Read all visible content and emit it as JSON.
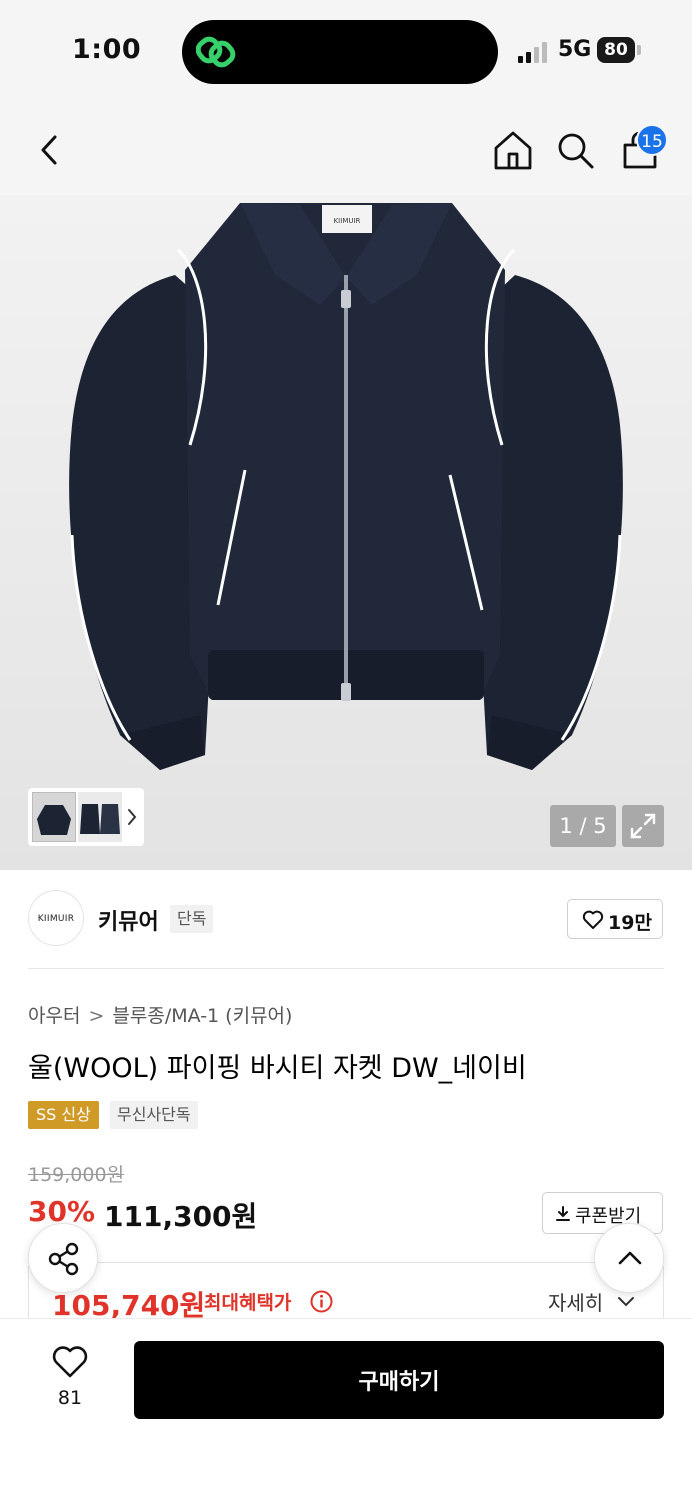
{
  "status_bar": {
    "time": "1:00",
    "network": "5G",
    "battery": "80"
  },
  "nav": {
    "back_icon": "chevron-left-icon",
    "home_icon": "home-icon",
    "search_icon": "search-icon",
    "cart_icon": "shopping-bag-icon",
    "cart_count": "15"
  },
  "gallery": {
    "image_label": "KIIMUIR",
    "counter": "1 / 5",
    "expand_icon": "expand-icon"
  },
  "brand": {
    "logo_text": "KIIMUIR",
    "name": "키뮤어",
    "tag": "단독",
    "like_count": "19만"
  },
  "product": {
    "breadcrumb": [
      "아우터",
      "블루종/MA-1 (키뮤어)"
    ],
    "title": "울(WOOL) 파이핑 바시티 자켓 DW_네이비",
    "badges": [
      "SS 신상",
      "무신사단독"
    ]
  },
  "price": {
    "original": "159,000원",
    "discount": "30%",
    "sale": "111,300원",
    "coupon_label": "쿠폰받기",
    "max_benefit_price": "105,740원",
    "max_benefit_label": "최대혜택가",
    "detail_label": "자세히"
  },
  "bottom": {
    "wish_count": "81",
    "buy_label": "구매하기"
  },
  "colors": {
    "accent_red": "#e0342b",
    "badge_gold": "#d09a27",
    "cart_badge_blue": "#1a73e8",
    "jacket_navy": "#1c2333"
  }
}
